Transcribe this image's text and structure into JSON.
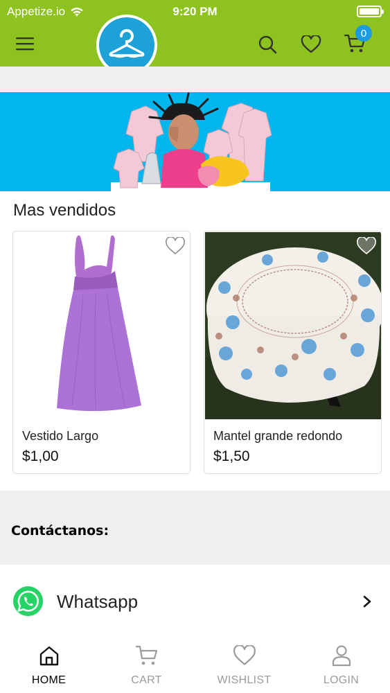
{
  "status_bar": {
    "carrier": "Appetize.io",
    "time": "9:20 PM"
  },
  "header": {
    "cart_count": "0"
  },
  "best_sellers": {
    "title": "Mas vendidos",
    "products": [
      {
        "name": "Vestido Largo",
        "price": "$1,00"
      },
      {
        "name": "Mantel grande redondo",
        "price": "$1,50"
      }
    ]
  },
  "contact": {
    "title": "Contáctanos:",
    "whatsapp_label": "Whatsapp"
  },
  "bottom_nav": {
    "items": [
      {
        "label": "HOME",
        "icon": "home-icon",
        "active": true
      },
      {
        "label": "CART",
        "icon": "cart-icon",
        "active": false
      },
      {
        "label": "WISHLIST",
        "icon": "heart-icon",
        "active": false
      },
      {
        "label": "LOGIN",
        "icon": "user-icon",
        "active": false
      }
    ]
  },
  "colors": {
    "header": "#8dc21f",
    "banner": "#00b6ec",
    "badge": "#1b9be0",
    "whatsapp": "#25d366"
  }
}
